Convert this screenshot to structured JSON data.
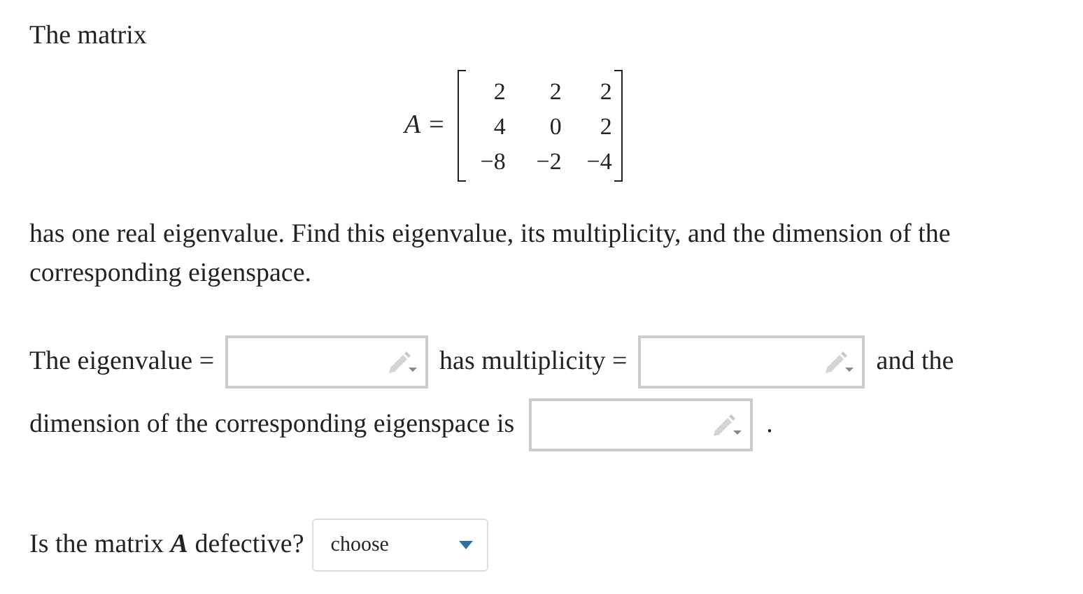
{
  "intro": "The matrix",
  "matrix": {
    "name": "A",
    "equals": "=",
    "rows": [
      [
        "2",
        "2",
        "2"
      ],
      [
        "4",
        "0",
        "2"
      ],
      [
        "−8",
        "−2",
        "−4"
      ]
    ]
  },
  "prompt": "has one real eigenvalue. Find this eigenvalue, its multiplicity, and the dimension of the corresponding eigenspace.",
  "answer_lines": [
    [
      {
        "kind": "text",
        "text": "The eigenvalue ="
      },
      {
        "kind": "input"
      },
      {
        "kind": "text",
        "text": "has multiplicity ="
      },
      {
        "kind": "input"
      },
      {
        "kind": "text",
        "text": "and the"
      }
    ],
    [
      {
        "kind": "text",
        "text": "dimension of the corresponding eigenspace is"
      },
      {
        "kind": "input"
      },
      {
        "kind": "text",
        "text": "."
      }
    ]
  ],
  "question": {
    "text": "Is the matrix *A* defective?",
    "dropdown": "choose"
  }
}
